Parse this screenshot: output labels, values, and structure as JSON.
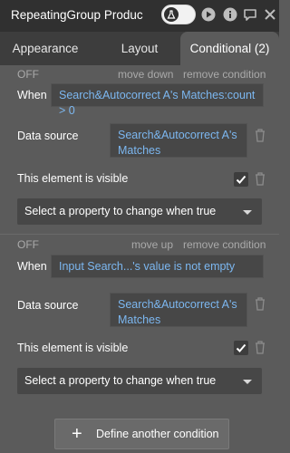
{
  "window": {
    "title": "RepeatingGroup Produc",
    "toggle_icon": "flask-icon",
    "icons": [
      "play-icon",
      "info-icon",
      "comment-icon",
      "close-icon"
    ]
  },
  "tabs": [
    {
      "label": "Appearance",
      "active": false
    },
    {
      "label": "Layout",
      "active": false
    },
    {
      "label": "Conditional (2)",
      "active": true
    }
  ],
  "conditions": [
    {
      "state": "OFF",
      "move_label": "move down",
      "remove_label": "remove condition",
      "when_label": "When",
      "when_value": "Search&Autocorrect A's Matches:count > 0",
      "datasource_label": "Data source",
      "datasource_value": "Search&Autocorrect A's Matches",
      "visible_label": "This element is visible",
      "visible_checked": true,
      "property_select": "Select a property to change when true"
    },
    {
      "state": "OFF",
      "move_label": "move up",
      "remove_label": "remove condition",
      "when_label": "When",
      "when_value": "Input Search...'s value is not empty",
      "datasource_label": "Data source",
      "datasource_value": "Search&Autocorrect A's Matches",
      "visible_label": "This element is visible",
      "visible_checked": true,
      "property_select": "Select a property to change when true"
    }
  ],
  "footer": {
    "define_button": "Define another condition"
  },
  "colors": {
    "panel": "#5b5b5b",
    "titlebar": "#303030",
    "tabbar": "#3d3d3d",
    "field": "#474747",
    "link_blue": "#7cb7f0",
    "dim_text": "#aaaaaa"
  }
}
